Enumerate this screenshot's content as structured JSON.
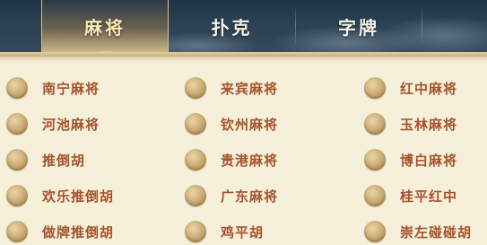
{
  "tabs": [
    {
      "label": "麻将",
      "active": true
    },
    {
      "label": "扑克",
      "active": false
    },
    {
      "label": "字牌",
      "active": false
    }
  ],
  "options": {
    "col1": [
      "南宁麻将",
      "河池麻将",
      "推倒胡",
      "欢乐推倒胡",
      "做牌推倒胡"
    ],
    "col2": [
      "来宾麻将",
      "钦州麻将",
      "贵港麻将",
      "广东麻将",
      "鸡平胡"
    ],
    "col3": [
      "红中麻将",
      "玉林麻将",
      "博白麻将",
      "桂平红中",
      "崇左碰碰胡"
    ]
  },
  "colors": {
    "background": "#f6efd9",
    "tabbar": "#2a4254",
    "active_tab_text": "#fbe7b2",
    "tab_text": "#f4f1e8",
    "label": "#a5532c",
    "radio": "#cfb07a"
  }
}
